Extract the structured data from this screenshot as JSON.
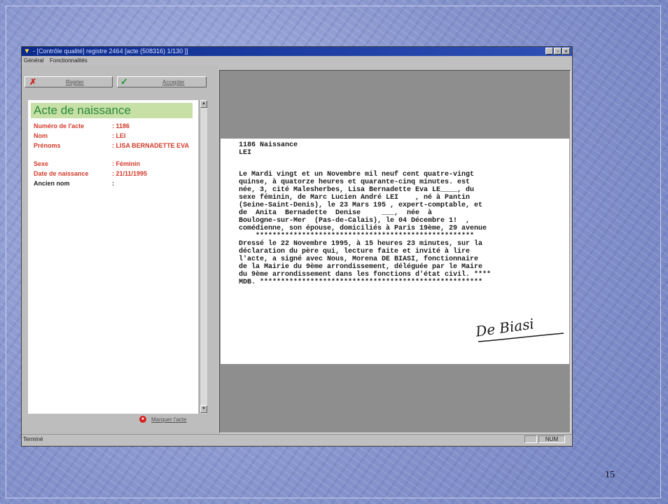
{
  "slide": {
    "page_number": "15"
  },
  "window": {
    "title": "- [Contrôle qualité] registre 2464 [acte (508316) 1/130 ]]",
    "menu": [
      "Général",
      "Fonctionnalités"
    ]
  },
  "toolbar": {
    "reject_label": "Rejeter",
    "accept_label": "Accepter"
  },
  "record": {
    "title": "Acte de naissance",
    "fields": [
      {
        "label": "Numéro de l'acte",
        "value": ": 1186"
      },
      {
        "label": "Nom",
        "value": ": LEI"
      },
      {
        "label": "Prénoms",
        "value": ": LISA BERNADETTE EVA"
      },
      {
        "label": "Sexe",
        "value": ": Féminin"
      },
      {
        "label": "Date de naissance",
        "value": ": 21/11/1995"
      },
      {
        "label": "Ancien nom",
        "value": ":"
      }
    ]
  },
  "mark_button": {
    "label": "Marquer l'acte"
  },
  "document": {
    "lines": [
      "1186 Naissance",
      "LEI",
      "",
      "Le Mardi vingt et un Novembre mil neuf cent quatre-vingt",
      "quinse, à quatorze heures et quarante-cinq minutes. est",
      "née, 3, cité Malesherbes, Lisa Bernadette Eva LE____, du",
      "sexe féminin, de Marc Lucien André LEI    , né à Pantin",
      "(Seine-Saint-Denis), le 23 Mars 195 , expert-comptable, et",
      "de  Anita  Bernadette  Denise     ___,  née  à",
      "Boulogne-sur-Mer  (Pas-de-Calais), le 04 Décembre 1!  ,",
      "comédienne, son épouse, domiciliés à Paris 19ème, 29 avenue",
      "    ****************************************************",
      "Dressé le 22 Novembre 1995, à 15 heures 23 minutes, sur la",
      "déclaration du père qui, lecture faite et invité à lire",
      "l'acte, a signé avec Nous, Morena DE BIASI, fonctionnaire",
      "de la Mairie du 9ème arrondissement, déléguée par le Maire",
      "du 9ème arrondissement dans les fonctions d'état civil. ****",
      "MDB. *****************************************************"
    ],
    "signature": "De Biasi"
  },
  "status": {
    "text": "Terminé",
    "num": "NUM"
  }
}
